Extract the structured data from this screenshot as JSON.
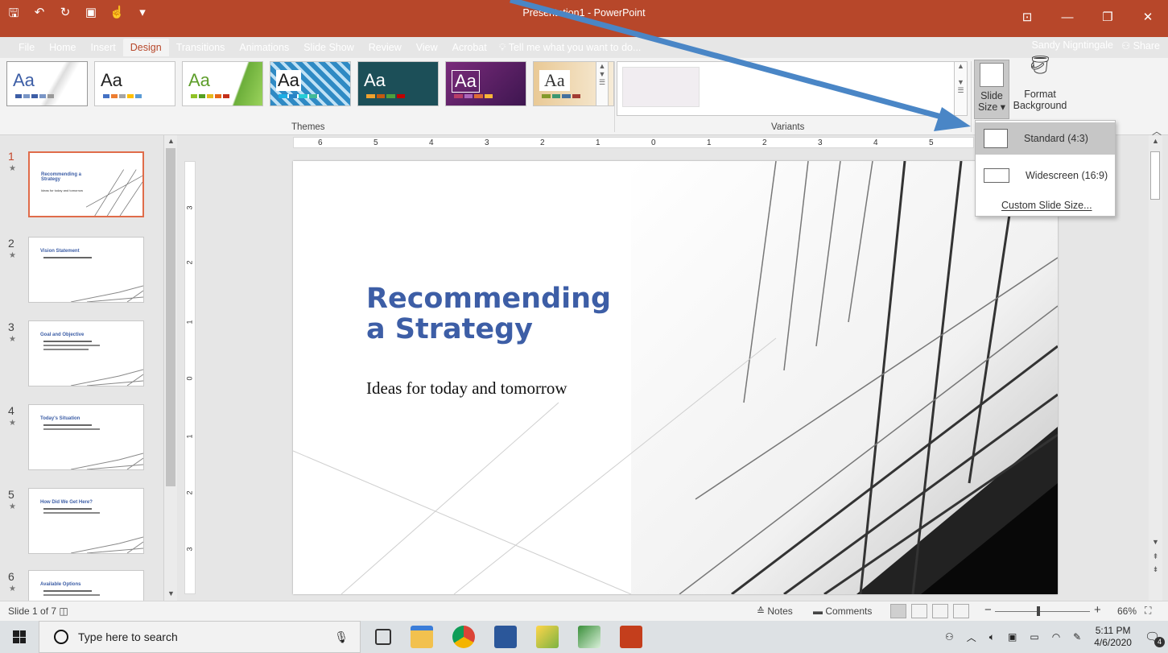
{
  "window": {
    "title": "Presentation1 - PowerPoint",
    "user": "Sandy Nigntingale",
    "share_label": "Share"
  },
  "tabs": [
    "File",
    "Home",
    "Insert",
    "Design",
    "Transitions",
    "Animations",
    "Slide Show",
    "Review",
    "View",
    "Acrobat"
  ],
  "active_tab": "Design",
  "tellme": "Tell me what you want to do...",
  "ribbon": {
    "themes_label": "Themes",
    "variants_label": "Variants",
    "theme_samples": [
      "Aa",
      "Aa",
      "Aa",
      "Aa",
      "Aa",
      "Aa",
      "Aa"
    ],
    "slide_size_label_1": "Slide",
    "slide_size_label_2": "Size",
    "format_bg_label_1": "Format",
    "format_bg_label_2": "Background"
  },
  "slide_size_menu": {
    "standard": "Standard (4:3)",
    "widescreen": "Widescreen (16:9)",
    "custom": "Custom Slide Size..."
  },
  "thumbnails": [
    {
      "num": "1",
      "title": "Recommending a Strategy",
      "sub": "Ideas for today and tomorrow"
    },
    {
      "num": "2",
      "title": "Vision Statement",
      "sub": ""
    },
    {
      "num": "3",
      "title": "Goal and Objective",
      "sub": ""
    },
    {
      "num": "4",
      "title": "Today's Situation",
      "sub": ""
    },
    {
      "num": "5",
      "title": "How Did We Get Here?",
      "sub": ""
    },
    {
      "num": "6",
      "title": "Available Options",
      "sub": ""
    }
  ],
  "slide": {
    "title": "Recommending\na Strategy",
    "subtitle": "Ideas for today and tomorrow"
  },
  "ruler": {
    "h_ticks": [
      "6",
      "5",
      "4",
      "3",
      "2",
      "1",
      "0",
      "1",
      "2",
      "3",
      "4",
      "5"
    ],
    "v_ticks": [
      "3",
      "2",
      "1",
      "0",
      "1",
      "2",
      "3"
    ]
  },
  "status": {
    "slide_count": "Slide 1 of 7",
    "notes": "Notes",
    "comments": "Comments",
    "zoom": "66%"
  },
  "taskbar": {
    "search_placeholder": "Type here to search",
    "time": "5:11 PM",
    "date": "4/6/2020",
    "notifications": "4"
  }
}
